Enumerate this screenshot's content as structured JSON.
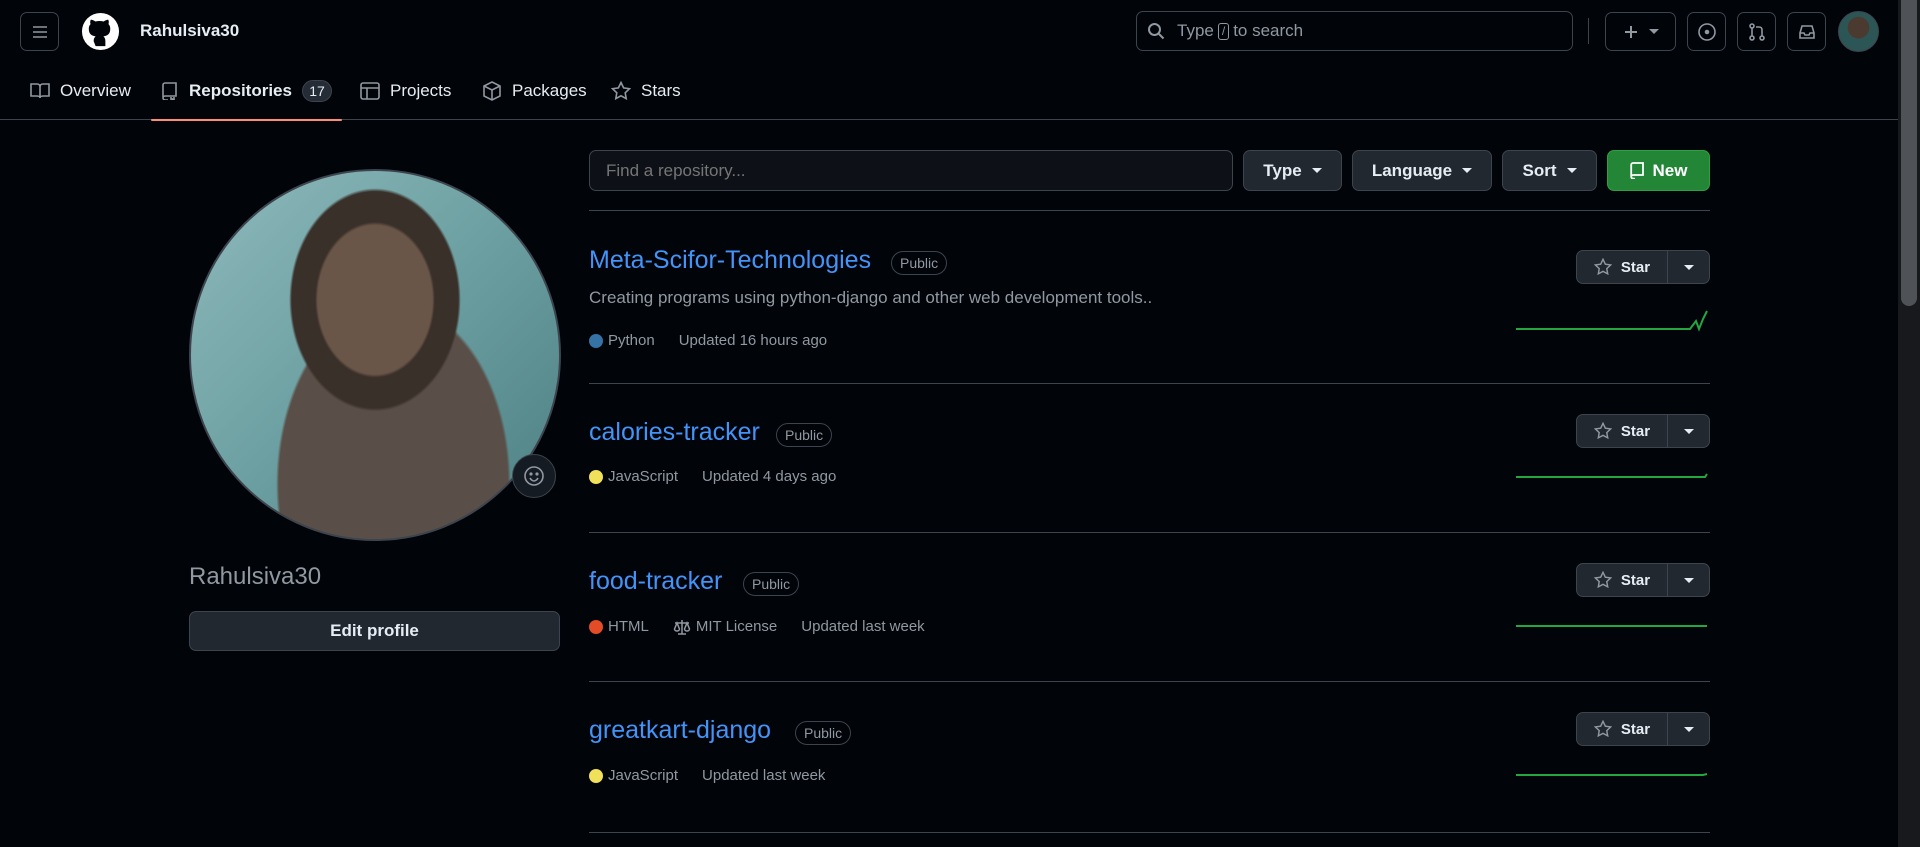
{
  "header": {
    "username": "Rahulsiva30",
    "search_placeholder_pre": "Type",
    "search_key": "/",
    "search_placeholder_post": "to search"
  },
  "tabs": [
    {
      "label": "Overview",
      "icon": "book-icon"
    },
    {
      "label": "Repositories",
      "icon": "repo-icon",
      "count": "17",
      "active": true
    },
    {
      "label": "Projects",
      "icon": "table-icon"
    },
    {
      "label": "Packages",
      "icon": "package-icon"
    },
    {
      "label": "Stars",
      "icon": "star-icon"
    }
  ],
  "profile": {
    "name": "Rahulsiva30",
    "edit_label": "Edit profile"
  },
  "filters": {
    "find_placeholder": "Find a repository...",
    "type_label": "Type",
    "language_label": "Language",
    "sort_label": "Sort",
    "new_label": "New"
  },
  "repos": [
    {
      "name": "Meta-Scifor-Technologies",
      "visibility": "Public",
      "description": "Creating programs using python-django and other web development tools..",
      "language": "Python",
      "language_color": "#3572A5",
      "updated": "Updated 16 hours ago",
      "star_label": "Star"
    },
    {
      "name": "calories-tracker",
      "visibility": "Public",
      "language": "JavaScript",
      "language_color": "#f1e05a",
      "updated": "Updated 4 days ago",
      "star_label": "Star"
    },
    {
      "name": "food-tracker",
      "visibility": "Public",
      "language": "HTML",
      "language_color": "#e34c26",
      "license": "MIT License",
      "updated": "Updated last week",
      "star_label": "Star"
    },
    {
      "name": "greatkart-django",
      "visibility": "Public",
      "language": "JavaScript",
      "language_color": "#f1e05a",
      "updated": "Updated last week",
      "star_label": "Star"
    }
  ],
  "colors": {
    "accent_link": "#4493f8",
    "new_button": "#238636",
    "active_tab_underline": "#fd8c73"
  }
}
